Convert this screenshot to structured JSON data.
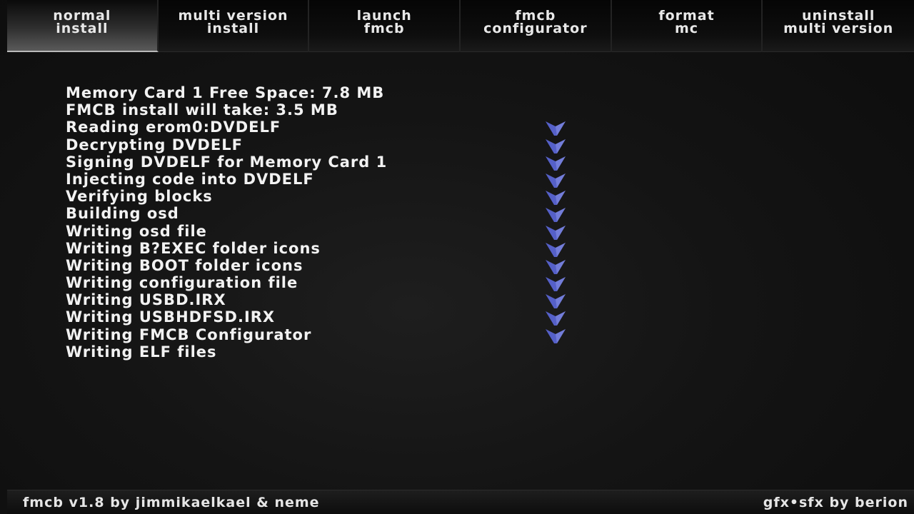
{
  "menu": {
    "tabs": [
      {
        "line1": "normal",
        "line2": "install"
      },
      {
        "line1": "multi version",
        "line2": "install"
      },
      {
        "line1": "launch",
        "line2": "fmcb"
      },
      {
        "line1": "fmcb",
        "line2": "configurator"
      },
      {
        "line1": "format",
        "line2": "mc"
      },
      {
        "line1": "uninstall",
        "line2": "multi version"
      }
    ]
  },
  "log": {
    "lines": [
      "Memory Card 1 Free Space: 7.8 MB",
      "FMCB install will take: 3.5 MB",
      "Reading erom0:DVDELF",
      "Decrypting DVDELF",
      "Signing DVDELF for Memory Card 1",
      "Injecting code into DVDELF",
      "Verifying blocks",
      "Building osd",
      "Writing osd file",
      "Writing B?EXEC folder icons",
      "Writing BOOT folder icons",
      "Writing configuration file",
      "Writing USBD.IRX",
      "Writing USBHDFSD.IRX",
      "Writing FMCB Configurator",
      "Writing ELF files"
    ],
    "check_icon": "checkmark-icon",
    "check_color": "#5560c8"
  },
  "footer": {
    "credit_left": "fmcb v1.8 by jimmikaelkael & neme",
    "credit_right": "gfx•sfx by berion"
  }
}
